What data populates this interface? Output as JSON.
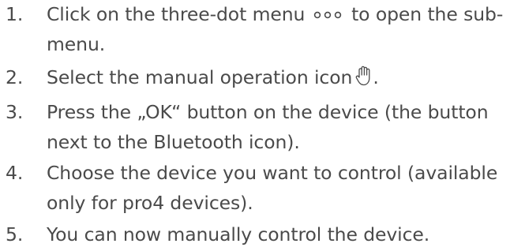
{
  "steps": [
    {
      "number": "1.",
      "line1_before": "Click on the three-dot menu",
      "icon": "three-dot-menu-icon",
      "line1_after": "to open the sub-",
      "line2": "menu."
    },
    {
      "number": "2.",
      "line1_before": "Select the manual operation icon",
      "icon": "hand-icon",
      "line1_after": "."
    },
    {
      "number": "3.",
      "line1": "Press the „OK“ button on the device (the button",
      "line2": "next to the Bluetooth icon)."
    },
    {
      "number": "4.",
      "line1": "Choose the device you want to control (available",
      "line2": "only for pro4 devices)."
    },
    {
      "number": "5.",
      "line1": "You can now manually control the device."
    }
  ],
  "colors": {
    "text": "#4a4a4a",
    "background": "#ffffff"
  }
}
